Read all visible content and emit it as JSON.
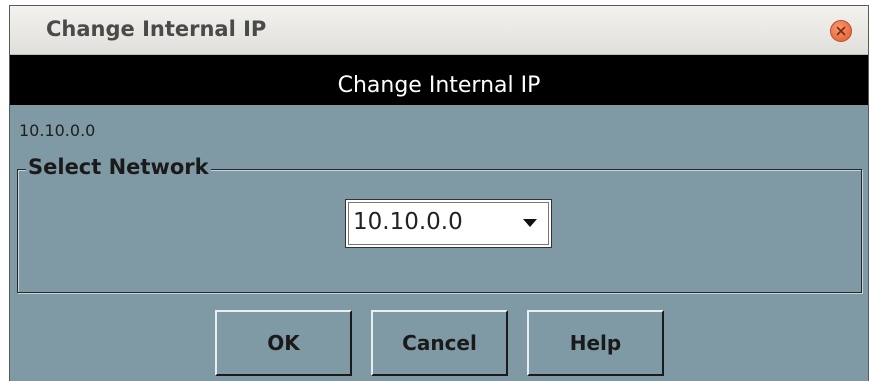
{
  "window": {
    "title": "Change Internal IP",
    "close_icon": "close-icon"
  },
  "header": {
    "title": "Change Internal IP"
  },
  "current_ip": "10.10.0.0",
  "network_group": {
    "legend": "Select Network",
    "selected_value": "10.10.0.0",
    "dropdown_icon": "triangle-down-icon"
  },
  "buttons": {
    "ok": "OK",
    "cancel": "Cancel",
    "help": "Help"
  },
  "colors": {
    "panel_background": "#7f9aa4",
    "header_band": "#000000",
    "close_button": "#e05a2a"
  }
}
